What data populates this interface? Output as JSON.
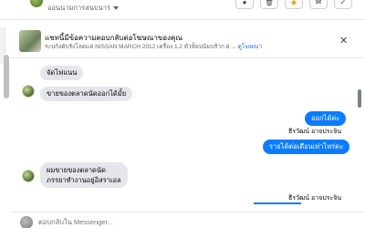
{
  "header": {
    "page_name": "ออนนามการสนบนาร",
    "buttons": [
      {
        "name": "info-button",
        "glyph": "●"
      },
      {
        "name": "trash-button",
        "glyph": "🗑"
      },
      {
        "name": "tag-button",
        "glyph": "◆"
      },
      {
        "name": "mail-button",
        "glyph": "✉"
      },
      {
        "name": "check-button",
        "glyph": "✓"
      }
    ]
  },
  "ad": {
    "title": "แชทนี้มีข้อความตอบกลับต่อโฆษณาของคุณ",
    "subtitle": "ระบกังดับรังโลดแต่ NISSAN MARCH 2012 เครื่อง 1.2 ตัวท็อปนัมบร้าก ผ่ ...",
    "link": "ดูโฆษณา",
    "close": "✕"
  },
  "messages": {
    "m1": "จัดไฟแนน",
    "m2": "ขายของตลาดนัดออกได้มั้ย",
    "m3": "ออกได้ค่ะ",
    "sender1": "ธีรวัฒน์ อาจประจิน",
    "m4": "รายได้ต่อเดือนเท่าไหร่คะ",
    "m5_line1": "ผมขายของตลาดนัด",
    "m5_line2": "ภรรยาทำงานอยู่อิสราเอล",
    "sender2": "ธีรวัฒน์ อาจประจิน"
  },
  "composer": {
    "placeholder": "ตอบกลับใน Messenger..."
  },
  "colors": {
    "accent": "#0a7cff",
    "incoming_bubble": "#e4e6eb"
  }
}
